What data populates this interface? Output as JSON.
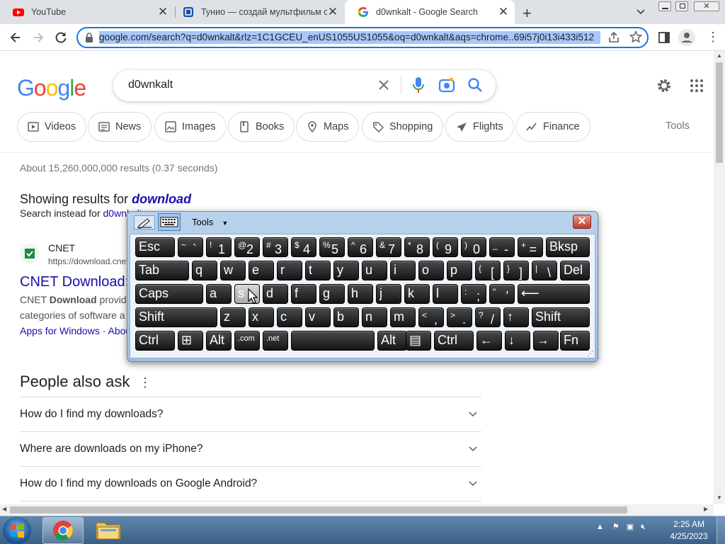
{
  "browser": {
    "tabs": [
      {
        "title": "YouTube",
        "active": false,
        "icon": "youtube-icon"
      },
      {
        "title": "Тунио — создай мультфильм онлайн",
        "active": false,
        "icon": "tunio-icon"
      },
      {
        "title": "d0wnkalt - Google Search",
        "active": true,
        "icon": "google-icon"
      }
    ],
    "new_tab": "+",
    "url": "google.com/search?q=d0wnkalt&rlz=1C1GCEU_enUS1055US1055&oq=d0wnkalt&aqs=chrome..69i57j0i13i433i512"
  },
  "search": {
    "logo": "Google",
    "query": "d0wnkalt",
    "chips": [
      "Videos",
      "News",
      "Images",
      "Books",
      "Maps",
      "Shopping",
      "Flights",
      "Finance"
    ],
    "tools": "Tools",
    "stats": "About 15,260,000,000 results (0.37 seconds)",
    "showing_prefix": "Showing results for ",
    "showing_term": "download",
    "instead_prefix": "Search instead for ",
    "instead_term": "d0wnkalt"
  },
  "result": {
    "site": "CNET",
    "url": "https://download.cnet.com",
    "title": "CNET Download:",
    "snippet_bold": "Download",
    "snippet1_prefix": "CNET ",
    "snippet1_suffix": " provide",
    "snippet2": "categories of software a",
    "sitelinks": "Apps for Windows · Abou"
  },
  "paa": {
    "heading": "People also ask",
    "questions": [
      "How do I find my downloads?",
      "Where are downloads on my iPhone?",
      "How do I find my downloads on Google Android?"
    ]
  },
  "osk": {
    "tools_label": "Tools",
    "close": "✕",
    "rows": [
      [
        {
          "t": "Esc"
        },
        {
          "s": "~",
          "l": "`"
        },
        {
          "s": "!",
          "l": "1"
        },
        {
          "s": "@",
          "l": "2"
        },
        {
          "s": "#",
          "l": "3"
        },
        {
          "s": "$",
          "l": "4"
        },
        {
          "s": "%",
          "l": "5"
        },
        {
          "s": "^",
          "l": "6"
        },
        {
          "s": "&",
          "l": "7"
        },
        {
          "s": "*",
          "l": "8"
        },
        {
          "s": "(",
          "l": "9"
        },
        {
          "s": ")",
          "l": "0"
        },
        {
          "s": "_",
          "l": "-"
        },
        {
          "s": "+",
          "l": "="
        },
        {
          "t": "Bksp"
        }
      ],
      [
        {
          "t": "Tab"
        },
        {
          "t": "q"
        },
        {
          "t": "w"
        },
        {
          "t": "e"
        },
        {
          "t": "r"
        },
        {
          "t": "t"
        },
        {
          "t": "y"
        },
        {
          "t": "u"
        },
        {
          "t": "i"
        },
        {
          "t": "o"
        },
        {
          "t": "p"
        },
        {
          "s": "{",
          "l": "["
        },
        {
          "s": "}",
          "l": "]"
        },
        {
          "s": "|",
          "l": "\\"
        },
        {
          "t": "Del"
        }
      ],
      [
        {
          "t": "Caps"
        },
        {
          "t": "a"
        },
        {
          "t": "s"
        },
        {
          "t": "d"
        },
        {
          "t": "f"
        },
        {
          "t": "g"
        },
        {
          "t": "h"
        },
        {
          "t": "j"
        },
        {
          "t": "k"
        },
        {
          "t": "l"
        },
        {
          "s": ":",
          "l": ";"
        },
        {
          "s": "\"",
          "l": "'"
        },
        {
          "t": "⟵"
        }
      ],
      [
        {
          "t": "Shift"
        },
        {
          "t": "z"
        },
        {
          "t": "x"
        },
        {
          "t": "c"
        },
        {
          "t": "v"
        },
        {
          "t": "b"
        },
        {
          "t": "n"
        },
        {
          "t": "m"
        },
        {
          "s": "<",
          "l": ","
        },
        {
          "s": ">",
          "l": "."
        },
        {
          "s": "?",
          "l": "/"
        },
        {
          "t": "↑"
        },
        {
          "t": "Shift"
        }
      ],
      [
        {
          "t": "Ctrl"
        },
        {
          "t": "⊞"
        },
        {
          "t": "Alt"
        },
        {
          "t": ".com"
        },
        {
          "t": ".net"
        },
        {
          "t": ""
        },
        {
          "t": "Alt"
        },
        {
          "t": "▤"
        },
        {
          "t": "Ctrl"
        },
        {
          "t": "←"
        },
        {
          "t": "↓"
        },
        {
          "t": "→"
        },
        {
          "t": "Fn"
        }
      ]
    ],
    "pressed_key": "s"
  },
  "taskbar": {
    "time": "2:25 AM",
    "date": "4/25/2023",
    "tray_arrow": "▲"
  },
  "colors": {
    "accent": "#1a73e8",
    "link": "#1a0dab",
    "taskbar": "#3a6087"
  }
}
